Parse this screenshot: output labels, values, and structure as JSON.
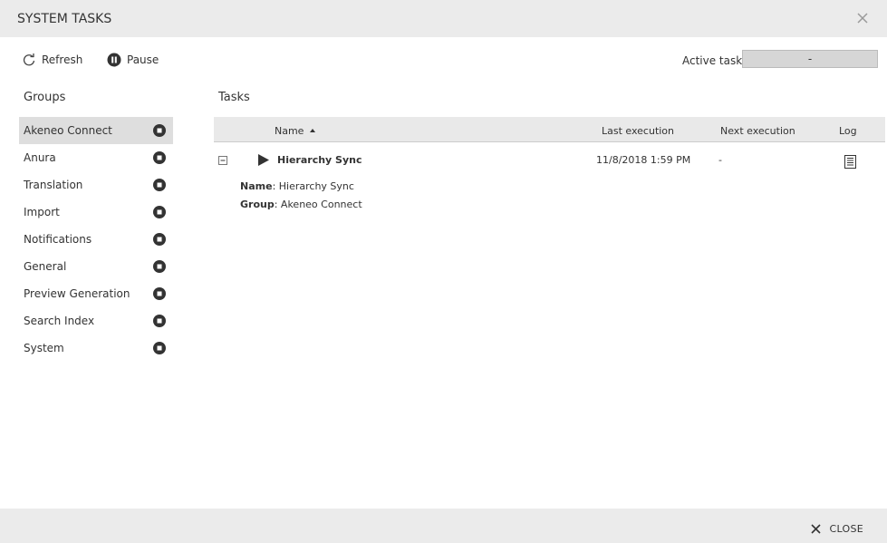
{
  "dialog": {
    "title": "SYSTEM TASKS"
  },
  "toolbar": {
    "refresh_label": "Refresh",
    "pause_label": "Pause",
    "active_task_label": "Active task: -",
    "active_task_value": "-"
  },
  "groups": {
    "title": "Groups",
    "items": [
      {
        "label": "Akeneo Connect"
      },
      {
        "label": "Anura"
      },
      {
        "label": "Translation"
      },
      {
        "label": "Import"
      },
      {
        "label": "Notifications"
      },
      {
        "label": "General"
      },
      {
        "label": "Preview Generation"
      },
      {
        "label": "Search Index"
      },
      {
        "label": "System"
      }
    ],
    "selected_index": 0
  },
  "tasks": {
    "title": "Tasks",
    "columns": {
      "name": "Name",
      "last_execution": "Last execution",
      "next_execution": "Next execution",
      "log": "Log"
    },
    "rows": [
      {
        "name": "Hierarchy Sync",
        "last_execution": "11/8/2018 1:59 PM",
        "next_execution": "-"
      }
    ],
    "detail": {
      "name_label": "Name",
      "name_value": ": Hierarchy Sync",
      "group_label": "Group",
      "group_value": ": Akeneo Connect"
    }
  },
  "footer": {
    "close_label": "CLOSE"
  }
}
